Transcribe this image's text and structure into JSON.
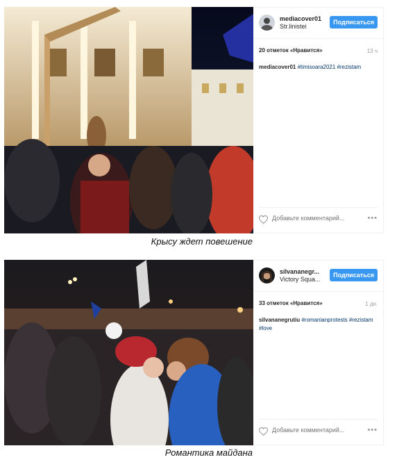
{
  "posts": [
    {
      "username": "mediacover01",
      "location": "Str.linistei",
      "follow_label": "Подписаться",
      "likes": "20 отметок «Нравится»",
      "time": "13 ч",
      "caption_user": "mediacover01",
      "tags": [
        "#timisoara2021",
        "#rezistam"
      ],
      "comment_placeholder": "Добавьте комментарий...",
      "more": "•••",
      "photo_caption": "Крысу ждет повешение",
      "icons": {
        "avatar": "avatar-icon",
        "like": "heart-icon",
        "options": "more-options-icon"
      }
    },
    {
      "username": "silvananegr...",
      "location": "Victory Squa...",
      "follow_label": "Подписаться",
      "likes": "33 отметок «Нравится»",
      "time": "1 дн.",
      "caption_user": "silvananegrutiu",
      "tags": [
        "#romanianprotests",
        "#rezistam",
        "#love"
      ],
      "comment_placeholder": "Добавьте комментарий...",
      "more": "•••",
      "photo_caption": "Романтика майдана",
      "icons": {
        "avatar": "avatar-icon",
        "like": "heart-icon",
        "options": "more-options-icon"
      }
    }
  ],
  "colors": {
    "follow_button": "#3897f0",
    "hashtag": "#003569",
    "muted": "#999999"
  }
}
